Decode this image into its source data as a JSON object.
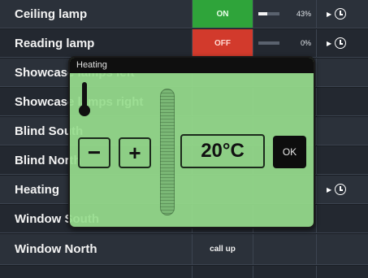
{
  "rows": [
    {
      "name": "Ceiling lamp",
      "state": "ON",
      "state_type": "on",
      "level_pct": "43%",
      "level_fraction": 0.43,
      "has_timer": true,
      "timer_icon": "clock-icon"
    },
    {
      "name": "Reading lamp",
      "state": "OFF",
      "state_type": "off",
      "level_pct": "0%",
      "level_fraction": 0.0,
      "has_timer": true,
      "timer_icon": "clock-icon"
    },
    {
      "name": "Showcase lamps left",
      "state": "",
      "state_type": "none"
    },
    {
      "name": "Showcase lamps right",
      "state": "",
      "state_type": "none"
    },
    {
      "name": "Blind South",
      "state": "",
      "state_type": "none"
    },
    {
      "name": "Blind North",
      "state": "",
      "state_type": "none"
    },
    {
      "name": "Heating",
      "state": "",
      "state_type": "none",
      "has_timer": true,
      "timer_icon": "clock-icon"
    },
    {
      "name": "Window South",
      "state": "",
      "state_type": "none"
    },
    {
      "name": "Window North",
      "state": "call up",
      "state_type": "callup"
    }
  ],
  "dialog": {
    "title": "Heating",
    "minus_label": "−",
    "plus_label": "+",
    "temperature": "20°C",
    "ok_label": "OK",
    "thermometer_icon": "thermometer-icon"
  },
  "colors": {
    "on": "#2fa43a",
    "off": "#d23a2c",
    "dialog_bg": "#96dc8c",
    "row_dark": "#232830",
    "row_light": "#2b313a"
  }
}
